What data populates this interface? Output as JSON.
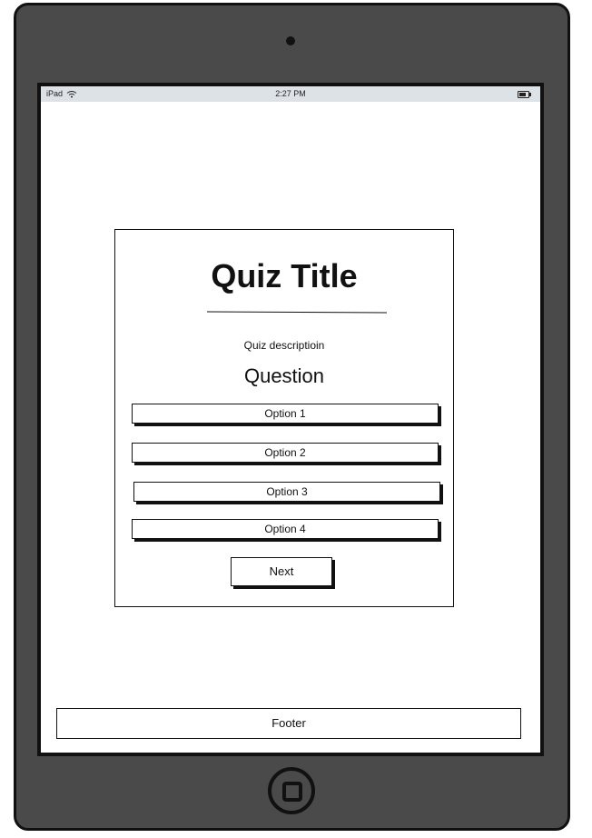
{
  "statusbar": {
    "device": "iPad",
    "time": "2:27 PM",
    "icons": [
      "wifi-icon",
      "battery-icon"
    ]
  },
  "quiz": {
    "title": "Quiz Title",
    "description": "Quiz descriptioin",
    "question": "Question",
    "options": [
      "Option 1",
      "Option 2",
      "Option 3",
      "Option 4"
    ],
    "next_label": "Next"
  },
  "footer": {
    "label": "Footer"
  }
}
